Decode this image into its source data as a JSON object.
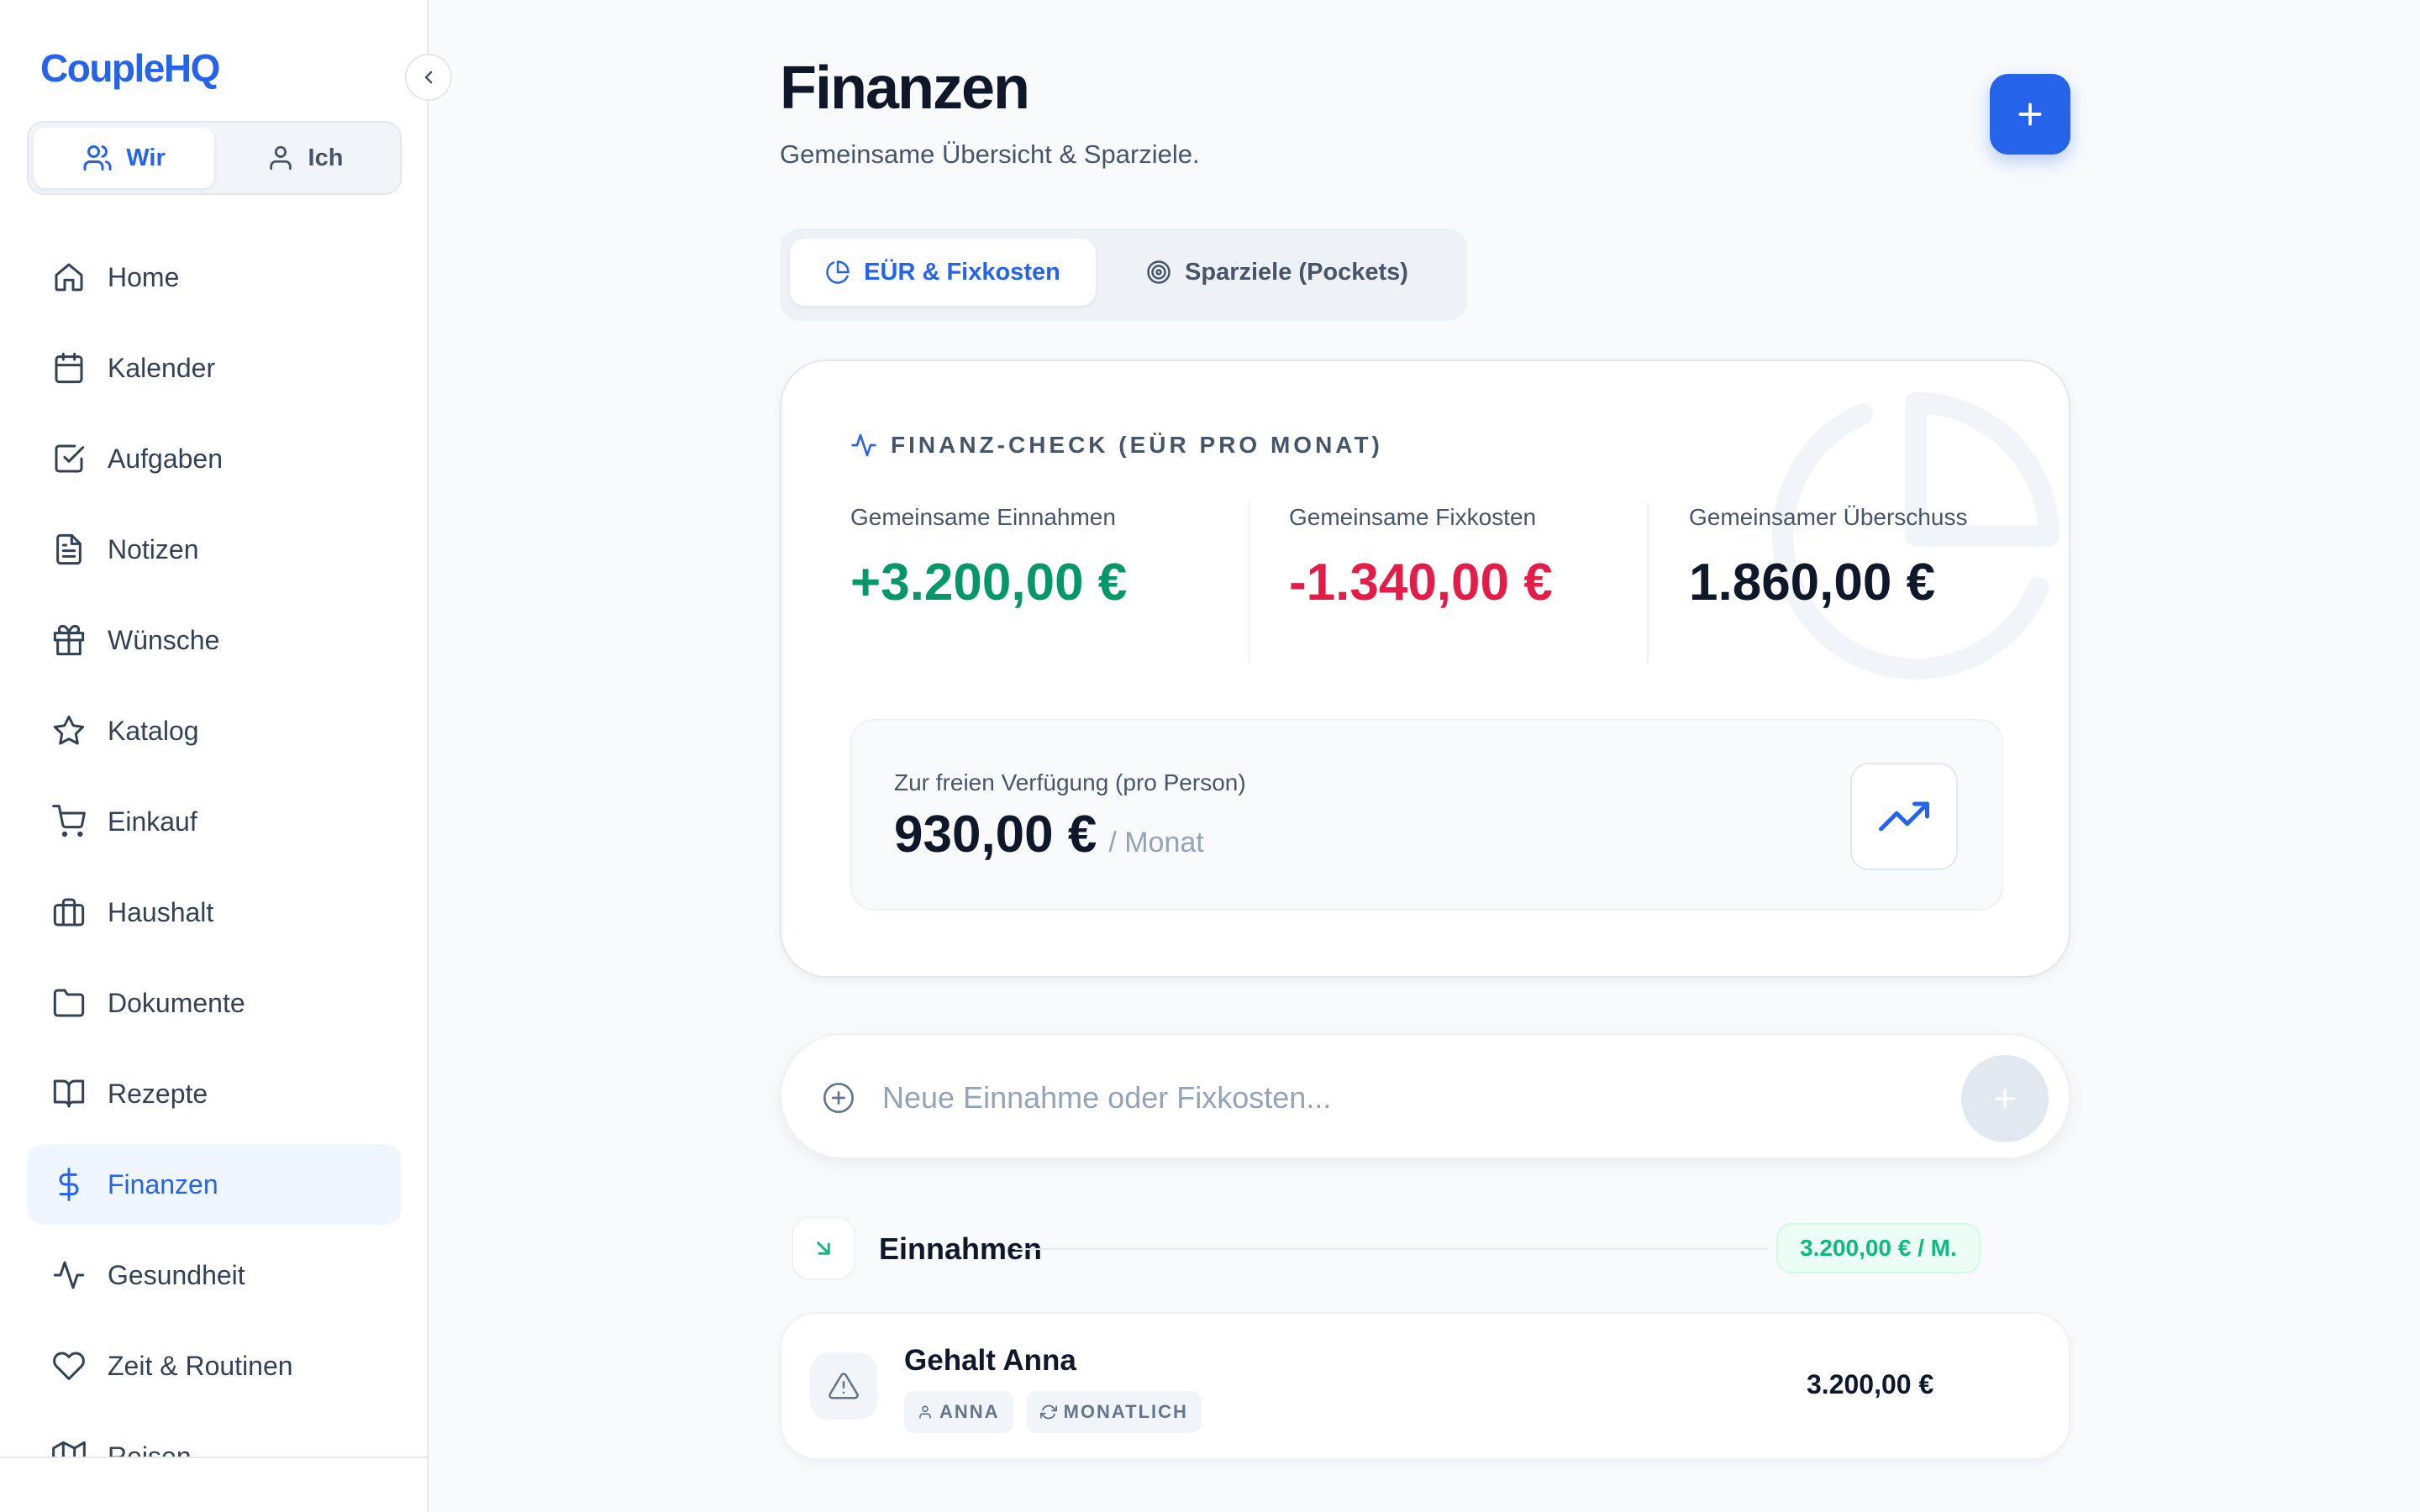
{
  "app": {
    "logo": "CoupleHQ"
  },
  "mode_switch": {
    "we_label": "Wir",
    "me_label": "Ich"
  },
  "sidebar": {
    "items": [
      {
        "label": "Home",
        "icon": "home-icon"
      },
      {
        "label": "Kalender",
        "icon": "calendar-icon"
      },
      {
        "label": "Aufgaben",
        "icon": "check-square-icon"
      },
      {
        "label": "Notizen",
        "icon": "file-text-icon"
      },
      {
        "label": "Wünsche",
        "icon": "gift-icon"
      },
      {
        "label": "Katalog",
        "icon": "star-icon"
      },
      {
        "label": "Einkauf",
        "icon": "shopping-cart-icon"
      },
      {
        "label": "Haushalt",
        "icon": "briefcase-icon"
      },
      {
        "label": "Dokumente",
        "icon": "folder-icon"
      },
      {
        "label": "Rezepte",
        "icon": "book-open-icon"
      },
      {
        "label": "Finanzen",
        "icon": "dollar-icon",
        "active": true
      },
      {
        "label": "Gesundheit",
        "icon": "activity-icon"
      },
      {
        "label": "Zeit & Routinen",
        "icon": "heart-icon"
      },
      {
        "label": "Reisen",
        "icon": "map-icon"
      }
    ]
  },
  "header": {
    "title": "Finanzen",
    "subtitle": "Gemeinsame Übersicht & Sparziele."
  },
  "tabs": [
    {
      "label": "EÜR & Fixkosten",
      "active": true
    },
    {
      "label": "Sparziele (Pockets)",
      "active": false
    }
  ],
  "finance_check": {
    "header": "FINANZ-CHECK (EÜR PRO MONAT)",
    "income": {
      "label": "Gemeinsame Einnahmen",
      "value": "+3.200,00 €"
    },
    "fixed_costs": {
      "label": "Gemeinsame Fixkosten",
      "value": "-1.340,00 €"
    },
    "surplus": {
      "label": "Gemeinsamer Überschuss",
      "value": "1.860,00 €"
    },
    "free": {
      "label": "Zur freien Verfügung (pro Person)",
      "value": "930,00 €",
      "unit": "/ Monat"
    }
  },
  "add_entry": {
    "placeholder": "Neue Einnahme oder Fixkosten..."
  },
  "income_section": {
    "title": "Einnahmen",
    "total": "3.200,00 € / M.",
    "entries": [
      {
        "title": "Gehalt Anna",
        "person_tag": "ANNA",
        "interval_tag": "MONATLICH",
        "amount": "3.200,00 €"
      }
    ]
  },
  "colors": {
    "accent": "#2563eb",
    "positive": "#059669",
    "negative": "#e11d48",
    "income_badge": "#10b981"
  }
}
